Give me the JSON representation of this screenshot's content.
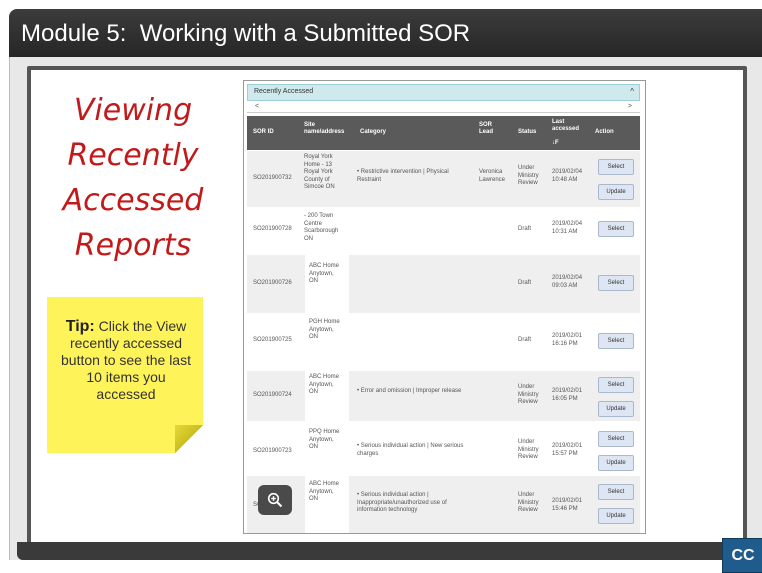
{
  "header": {
    "title": "Module 5:  Working with a Submitted SOR"
  },
  "slide_title": {
    "lines": [
      "Viewing",
      "Recently",
      "Accessed",
      "Reports"
    ]
  },
  "tip": {
    "label": "Tip:",
    "text": "Click the View recently accessed button to see the last 10 items you accessed"
  },
  "panel": {
    "heading": "Recently Accessed",
    "caret": "^",
    "scroll_left": "<",
    "scroll_right": ">",
    "columns": [
      "SOR ID",
      "Site name/address",
      "Category",
      "SOR Lead",
      "Status",
      "Last accessed",
      "Action"
    ],
    "last_accessed_sort_icon": "↓F",
    "rows": [
      {
        "sor_id": "SO201900732",
        "site": "Royal York Home - 13 Royal York County of Simcoe ON",
        "category": "• Restrictive intervention | Physical Restraint",
        "lead": "Veronica Lawrence",
        "status": "Under Ministry Review",
        "date": "2019/02/04",
        "time": "10:48 AM",
        "actions": [
          "Select",
          "Update"
        ]
      },
      {
        "sor_id": "SO201900728",
        "site": "- 200 Town Centre Scarborough ON",
        "category": "",
        "lead": "",
        "status": "Draft",
        "date": "2019/02/04",
        "time": "10:31 AM",
        "actions": [
          "Select"
        ]
      },
      {
        "sor_id": "SO201900726",
        "site": "ABC Home Anytown, ON",
        "category": "",
        "lead": "",
        "status": "Draft",
        "date": "2019/02/04",
        "time": "09:03 AM",
        "actions": [
          "Select"
        ]
      },
      {
        "sor_id": "SO201900725",
        "site": "PGH Home Anytown, ON",
        "category": "",
        "lead": "",
        "status": "Draft",
        "date": "2019/02/01",
        "time": "16:16 PM",
        "actions": [
          "Select"
        ]
      },
      {
        "sor_id": "SO201900724",
        "site": "ABC Home Anytown, ON",
        "category": "• Error and omission | Improper release",
        "lead": "",
        "status": "Under Ministry Review",
        "date": "2019/02/01",
        "time": "16:05 PM",
        "actions": [
          "Select",
          "Update"
        ]
      },
      {
        "sor_id": "SO201900723",
        "site": "PPQ Home Anytown, ON",
        "category": "• Serious individual action | New serious charges",
        "lead": "",
        "status": "Under Ministry Review",
        "date": "2019/02/01",
        "time": "15:57 PM",
        "actions": [
          "Select",
          "Update"
        ]
      },
      {
        "sor_id": "SO201900722",
        "site": "ABC Home Anytown, ON",
        "category": "• Serious individual action | Inappropriate/unauthorized use of information technology",
        "lead": "",
        "status": "Under Ministry Review",
        "date": "2019/02/01",
        "time": "15:46 PM",
        "actions": [
          "Select",
          "Update"
        ]
      }
    ]
  },
  "zoom_icon": "magnifier-plus-icon",
  "cc_label": "CC"
}
